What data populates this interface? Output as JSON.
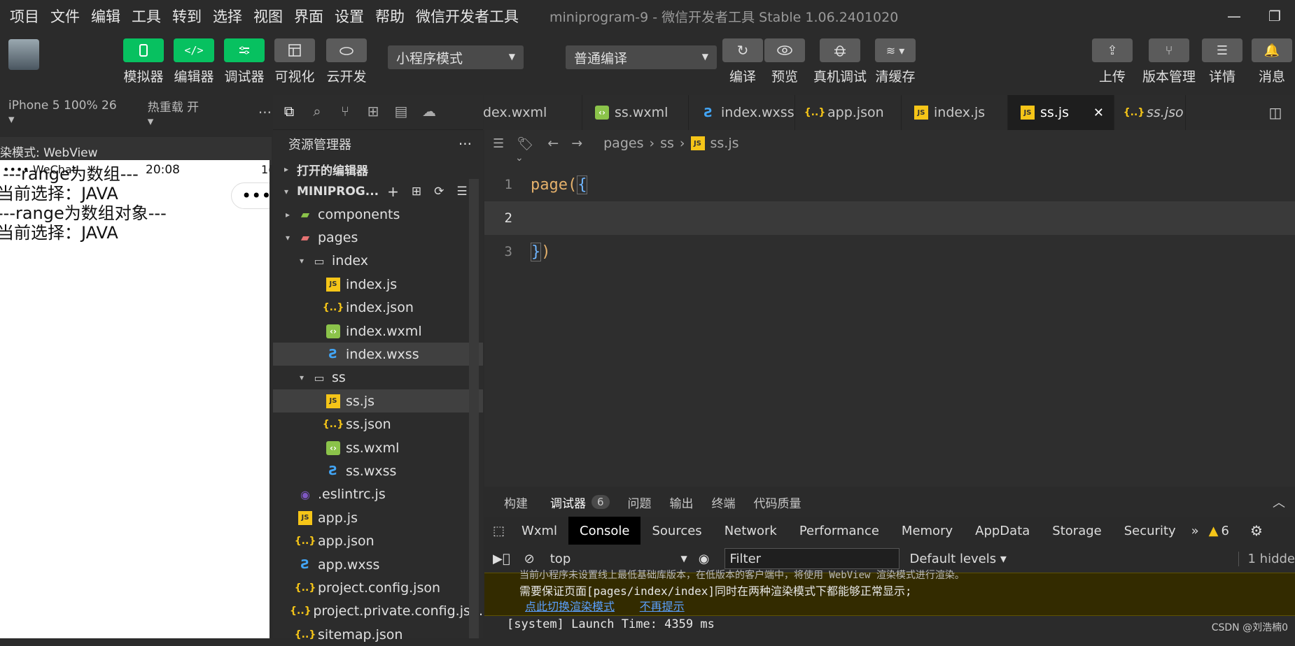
{
  "menubar": {
    "items": [
      "项目",
      "文件",
      "编辑",
      "工具",
      "转到",
      "选择",
      "视图",
      "界面",
      "设置",
      "帮助",
      "微信开发者工具"
    ],
    "title": "miniprogram-9 - 微信开发者工具 Stable 1.06.2401020"
  },
  "toolbar": {
    "simulator": "模拟器",
    "editor": "编辑器",
    "debugger": "调试器",
    "visual": "可视化",
    "cloud": "云开发",
    "mode_select": "小程序模式",
    "compile_select": "普通编译",
    "compile": "编译",
    "preview": "预览",
    "device_debug": "真机调试",
    "clear_cache": "清缓存",
    "upload": "上传",
    "version": "版本管理",
    "details": "详情",
    "messages": "消息"
  },
  "simulator": {
    "device": "iPhone 5 100% 26 ▾",
    "hotreload": "热重载 开 ▾",
    "more": "···",
    "render_mode": "染模式: WebView",
    "status_time": "20:08",
    "status_left": "•••• WeChat",
    "status_right": "1(",
    "lines": [
      "---range为数组---",
      "当前选择：JAVA",
      "---range为数组对象---",
      "当前选择：JAVA"
    ]
  },
  "explorer": {
    "title": "资源管理器",
    "more": "···",
    "open_editors": "打开的编辑器",
    "project": "MINIPROG...",
    "items": [
      {
        "label": "components",
        "type": "folder-green",
        "depth": 1,
        "caret": "▸"
      },
      {
        "label": "pages",
        "type": "folder-red",
        "depth": 1,
        "caret": "▾"
      },
      {
        "label": "index",
        "type": "folder",
        "depth": 2,
        "caret": "▾"
      },
      {
        "label": "index.js",
        "type": "js",
        "depth": 3,
        "caret": ""
      },
      {
        "label": "index.json",
        "type": "json",
        "depth": 3,
        "caret": ""
      },
      {
        "label": "index.wxml",
        "type": "wxml",
        "depth": 3,
        "caret": ""
      },
      {
        "label": "index.wxss",
        "type": "wxss",
        "depth": 3,
        "caret": ""
      },
      {
        "label": "ss",
        "type": "folder",
        "depth": 2,
        "caret": "▾"
      },
      {
        "label": "ss.js",
        "type": "js",
        "depth": 3,
        "caret": ""
      },
      {
        "label": "ss.json",
        "type": "json",
        "depth": 3,
        "caret": ""
      },
      {
        "label": "ss.wxml",
        "type": "wxml",
        "depth": 3,
        "caret": ""
      },
      {
        "label": "ss.wxss",
        "type": "wxss",
        "depth": 3,
        "caret": ""
      },
      {
        "label": ".eslintrc.js",
        "type": "eslint",
        "depth": 1,
        "caret": ""
      },
      {
        "label": "app.js",
        "type": "js",
        "depth": 1,
        "caret": ""
      },
      {
        "label": "app.json",
        "type": "json",
        "depth": 1,
        "caret": ""
      },
      {
        "label": "app.wxss",
        "type": "wxss",
        "depth": 1,
        "caret": ""
      },
      {
        "label": "project.config.json",
        "type": "json",
        "depth": 1,
        "caret": ""
      },
      {
        "label": "project.private.config.js...",
        "type": "json",
        "depth": 1,
        "caret": ""
      },
      {
        "label": "sitemap.json",
        "type": "json",
        "depth": 1,
        "caret": ""
      }
    ]
  },
  "tabs": [
    {
      "label": "dex.wxml",
      "type": "none"
    },
    {
      "label": "ss.wxml",
      "type": "wxml"
    },
    {
      "label": "index.wxss",
      "type": "wxss"
    },
    {
      "label": "app.json",
      "type": "json"
    },
    {
      "label": "index.js",
      "type": "js"
    },
    {
      "label": "ss.js",
      "type": "js"
    },
    {
      "label": "ss.jso",
      "type": "json"
    }
  ],
  "breadcrumb": {
    "parts": [
      "pages",
      "ss",
      "ss.js"
    ]
  },
  "code": {
    "line1_fn": "page(",
    "line1_brace": "{",
    "line3_brace": "}",
    "line3_paren": ")",
    "numbers": [
      "1",
      "2",
      "3"
    ]
  },
  "debug": {
    "tabs": [
      "构建",
      "调试器",
      "问题",
      "输出",
      "终端",
      "代码质量"
    ],
    "badge": "6",
    "devtabs": [
      "Wxml",
      "Console",
      "Sources",
      "Network",
      "Performance",
      "Memory",
      "AppData",
      "Storage",
      "Security"
    ],
    "more": "»",
    "warn_count": "6",
    "context": "top",
    "filter_placeholder": "Filter",
    "levels": "Default levels ▾",
    "hidden": "1 hidde",
    "warn_line1": "当前小程序未设置线上最低基础库版本，在低版本的客户端中，将使用 WebView 渲染模式进行渲染。",
    "warn_line2": "需要保证页面[pages/index/index]同时在两种渲染模式下都能够正常显示;",
    "link1": "点此切换渲染模式",
    "link2": "不再提示",
    "system": "[system] Launch Time: 4359 ms"
  },
  "watermark": "CSDN @刘浩楠0",
  "colors": {
    "accent": "#07c160",
    "keyword": "#e5b16b",
    "warn_bg": "#332b00"
  }
}
